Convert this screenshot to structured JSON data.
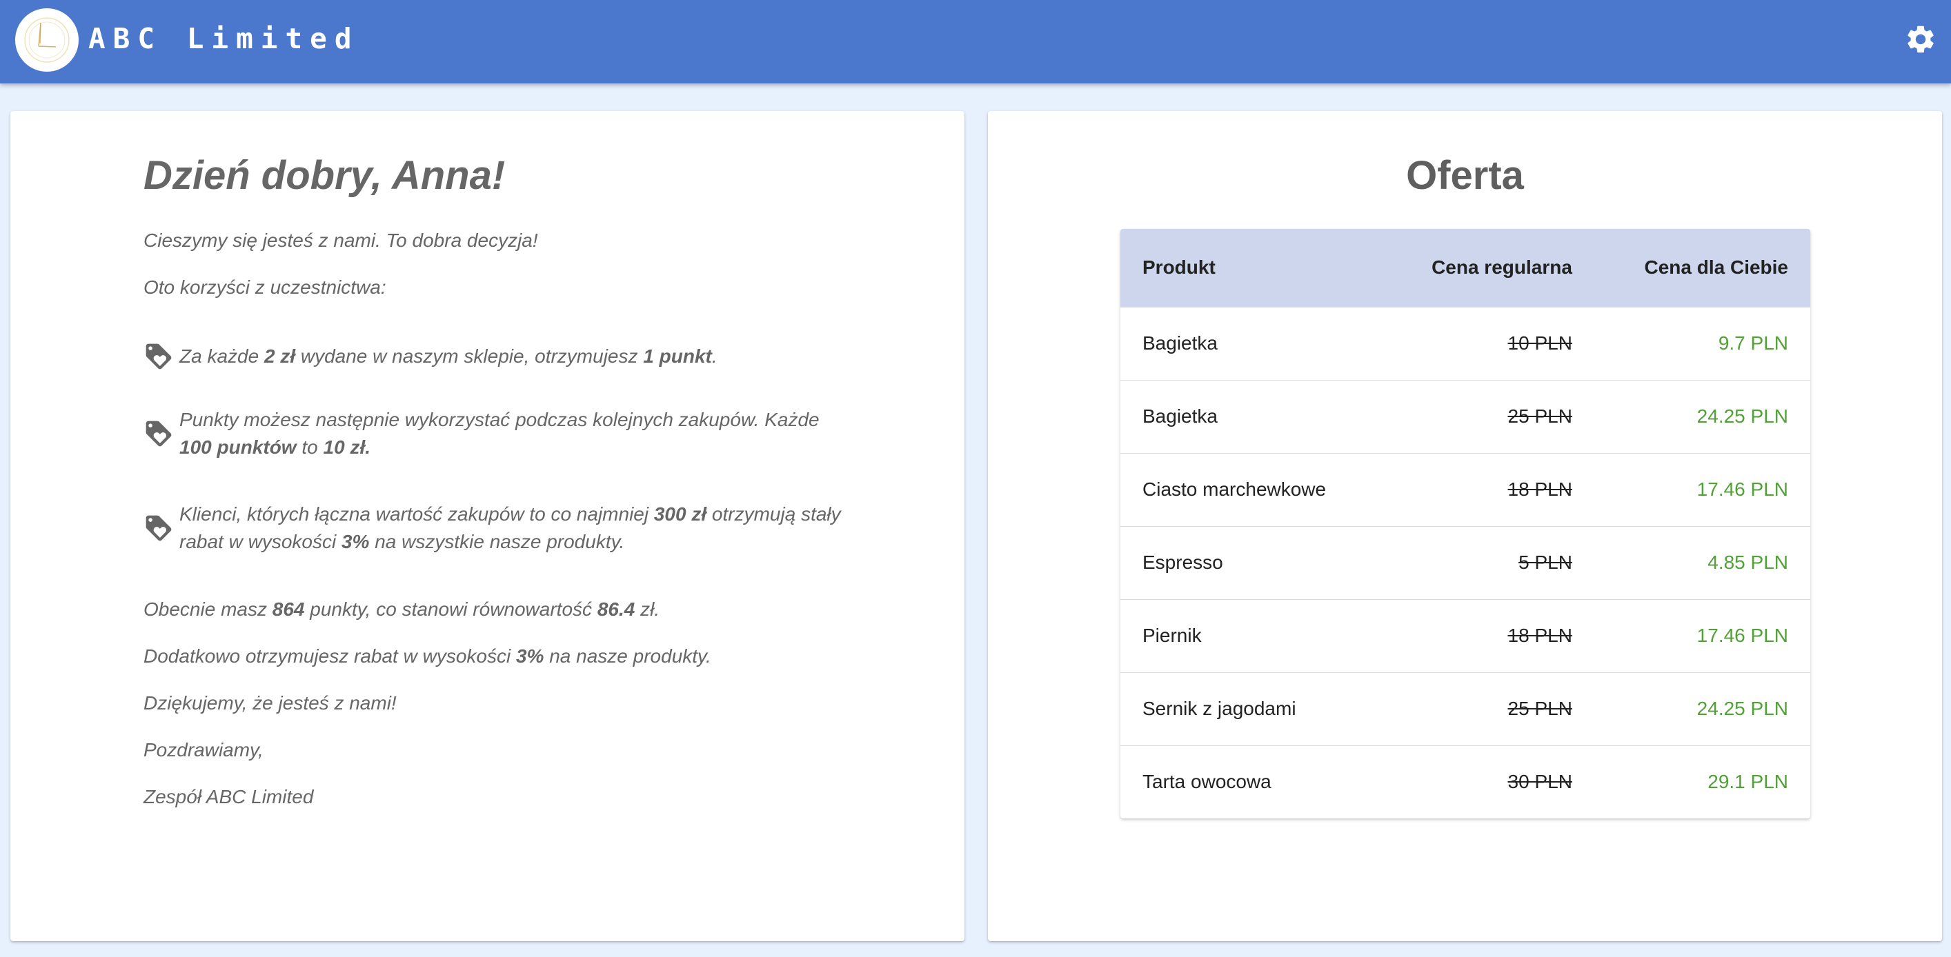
{
  "app": {
    "brand": "ABC Limited",
    "colors": {
      "appbar": "#4b77cd",
      "background": "#e7f0fd",
      "price_green": "#52a038",
      "table_header": "#cdd6ec"
    },
    "icons": {
      "logo": "clock-logo-icon",
      "settings": "gear-icon",
      "benefit": "tag-heart-icon"
    }
  },
  "welcome": {
    "greeting": "Dzień dobry, Anna!",
    "intro": "Cieszymy się jesteś z nami. To dobra decyzja!",
    "benefits_intro": "Oto korzyści z uczestnictwa:",
    "benefit1": {
      "a": "Za każde ",
      "b": "2 zł",
      "c": " wydane w naszym sklepie, otrzymujesz ",
      "d": "1 punkt",
      "e": "."
    },
    "benefit2": {
      "a": "Punkty możesz następnie wykorzystać podczas kolejnych zakupów. Każde ",
      "b": "100 punktów",
      "c": " to ",
      "d": "10 zł."
    },
    "benefit3": {
      "a": "Klienci, których łączna wartość zakupów to co najmniej ",
      "b": "300 zł",
      "c": " otrzymują stały rabat w wysokości ",
      "d": "3%",
      "e": " na wszystkie nasze produkty."
    },
    "points": {
      "a": "Obecnie masz ",
      "b": "864",
      "c": " punkty, co stanowi równowartość ",
      "d": "86.4",
      "e": " zł."
    },
    "discount": {
      "a": "Dodatkowo otrzymujesz rabat w wysokości ",
      "b": "3%",
      "c": " na nasze produkty."
    },
    "thanks": "Dziękujemy, że jesteś z nami!",
    "regards": "Pozdrawiamy,",
    "signature": "Zespół ABC Limited"
  },
  "offer": {
    "title": "Oferta",
    "columns": [
      "Produkt",
      "Cena regularna",
      "Cena dla Ciebie"
    ],
    "rows": [
      {
        "product": "Bagietka",
        "regular": "10 PLN",
        "yours": "9.7 PLN"
      },
      {
        "product": "Bagietka",
        "regular": "25 PLN",
        "yours": "24.25 PLN"
      },
      {
        "product": "Ciasto marchewkowe",
        "regular": "18 PLN",
        "yours": "17.46 PLN"
      },
      {
        "product": "Espresso",
        "regular": "5 PLN",
        "yours": "4.85 PLN"
      },
      {
        "product": "Piernik",
        "regular": "18 PLN",
        "yours": "17.46 PLN"
      },
      {
        "product": "Sernik z jagodami",
        "regular": "25 PLN",
        "yours": "24.25 PLN"
      },
      {
        "product": "Tarta owocowa",
        "regular": "30 PLN",
        "yours": "29.1 PLN"
      }
    ]
  }
}
